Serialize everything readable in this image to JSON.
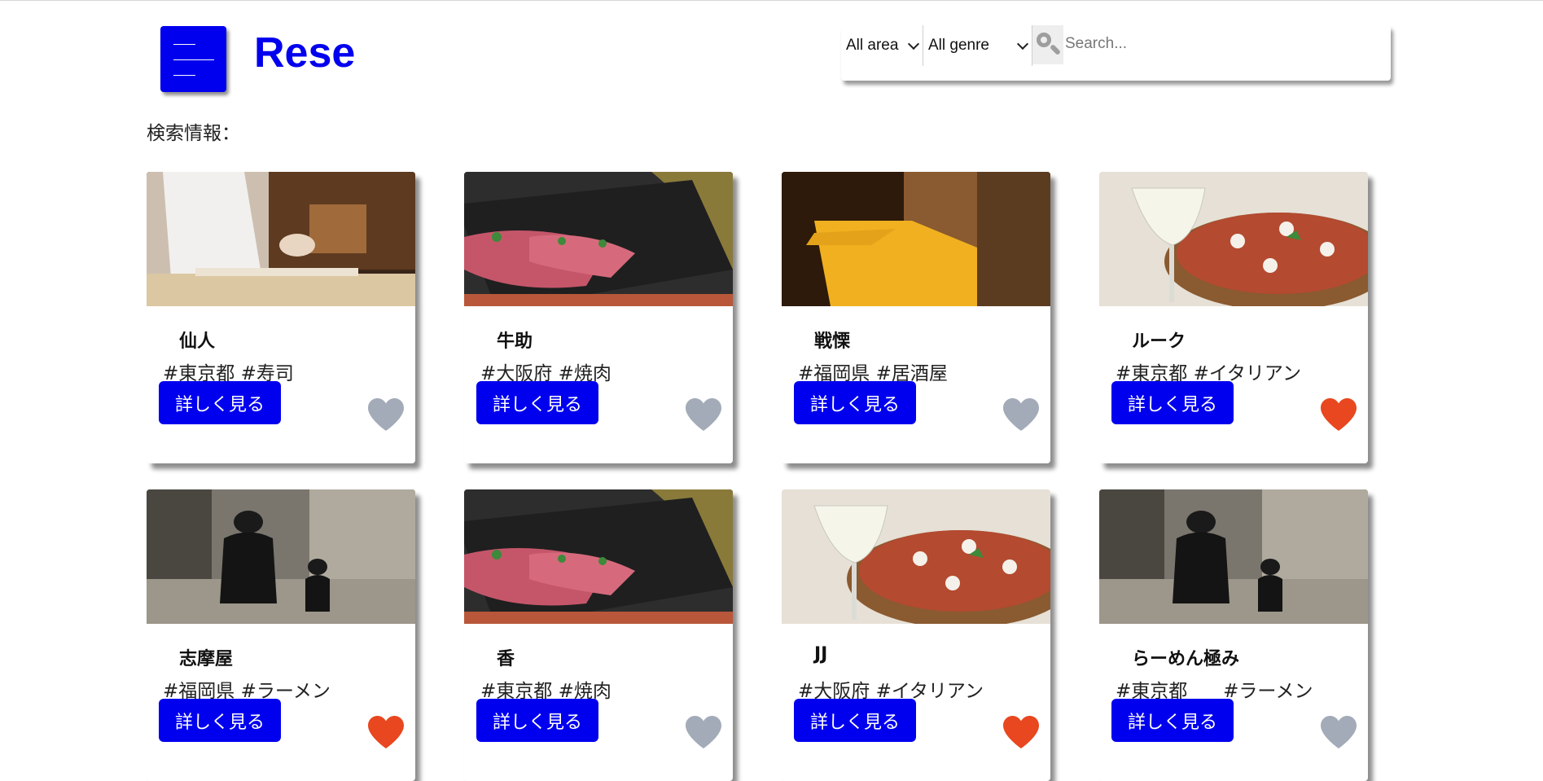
{
  "header": {
    "logo": "Rese",
    "area_select": "All area",
    "genre_select": "All genre",
    "search_placeholder": "Search..."
  },
  "search_info_label": "検索情報：",
  "detail_label": "詳しく見る",
  "colors": {
    "accent": "#0000ee",
    "heart_liked": "#e8471f",
    "heart_unliked": "#a3abb8"
  },
  "shops": [
    {
      "name": "仙人",
      "tags": "#東京都 #寿司",
      "liked": false,
      "photo": "sushi"
    },
    {
      "name": "牛助",
      "tags": "#大阪府 #焼肉",
      "liked": false,
      "photo": "yakiniku"
    },
    {
      "name": "戦慄",
      "tags": "#福岡県 #居酒屋",
      "liked": false,
      "photo": "izakaya"
    },
    {
      "name": "ルーク",
      "tags": "#東京都 #イタリアン",
      "liked": true,
      "photo": "pizza"
    },
    {
      "name": "志摩屋",
      "tags": "#福岡県 #ラーメン",
      "liked": true,
      "photo": "ramen"
    },
    {
      "name": "香",
      "tags": "#東京都 #焼肉",
      "liked": false,
      "photo": "yakiniku"
    },
    {
      "name": "JJ",
      "tags": "#大阪府 #イタリアン",
      "liked": true,
      "photo": "pizza"
    },
    {
      "name": "らーめん極み",
      "tags": "#東京都      #ラーメン",
      "liked": false,
      "photo": "ramen"
    }
  ]
}
